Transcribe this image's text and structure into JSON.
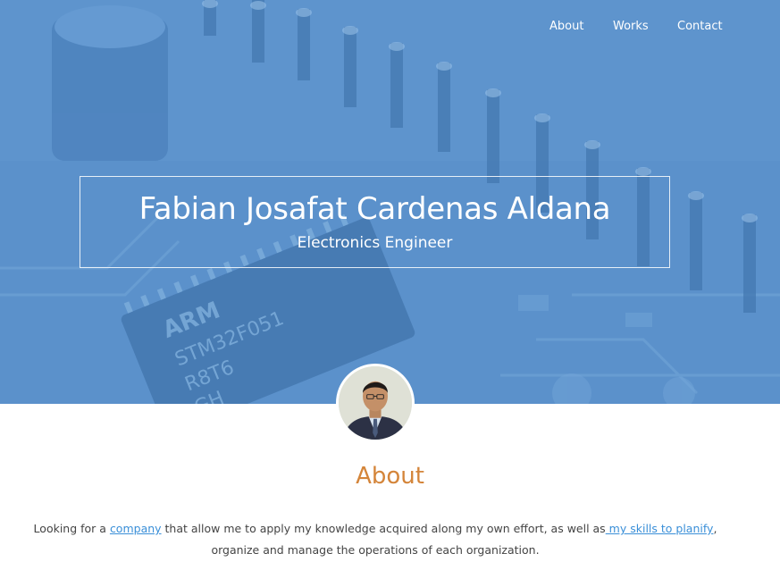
{
  "nav": {
    "items": [
      "About",
      "Works",
      "Contact"
    ]
  },
  "hero": {
    "name": "Fabian Josafat Cardenas Aldana",
    "subtitle": "Electronics Engineer",
    "chip_marking_lines": [
      "ARM",
      "STM32F051",
      "R8T6",
      "GH"
    ]
  },
  "about": {
    "heading": "About",
    "text_parts": {
      "p1": "Looking for a ",
      "link1": "company",
      "p2": " that allow me to apply my knowledge acquired along my own effort, as well as",
      "link2": " my skills to planify",
      "p3": ", organize and manage the operations of each organization."
    }
  },
  "colors": {
    "hero_blue": "#5a8dc8",
    "accent_orange": "#d4853a",
    "link_blue": "#3a8fd8",
    "body_text": "#444444"
  }
}
